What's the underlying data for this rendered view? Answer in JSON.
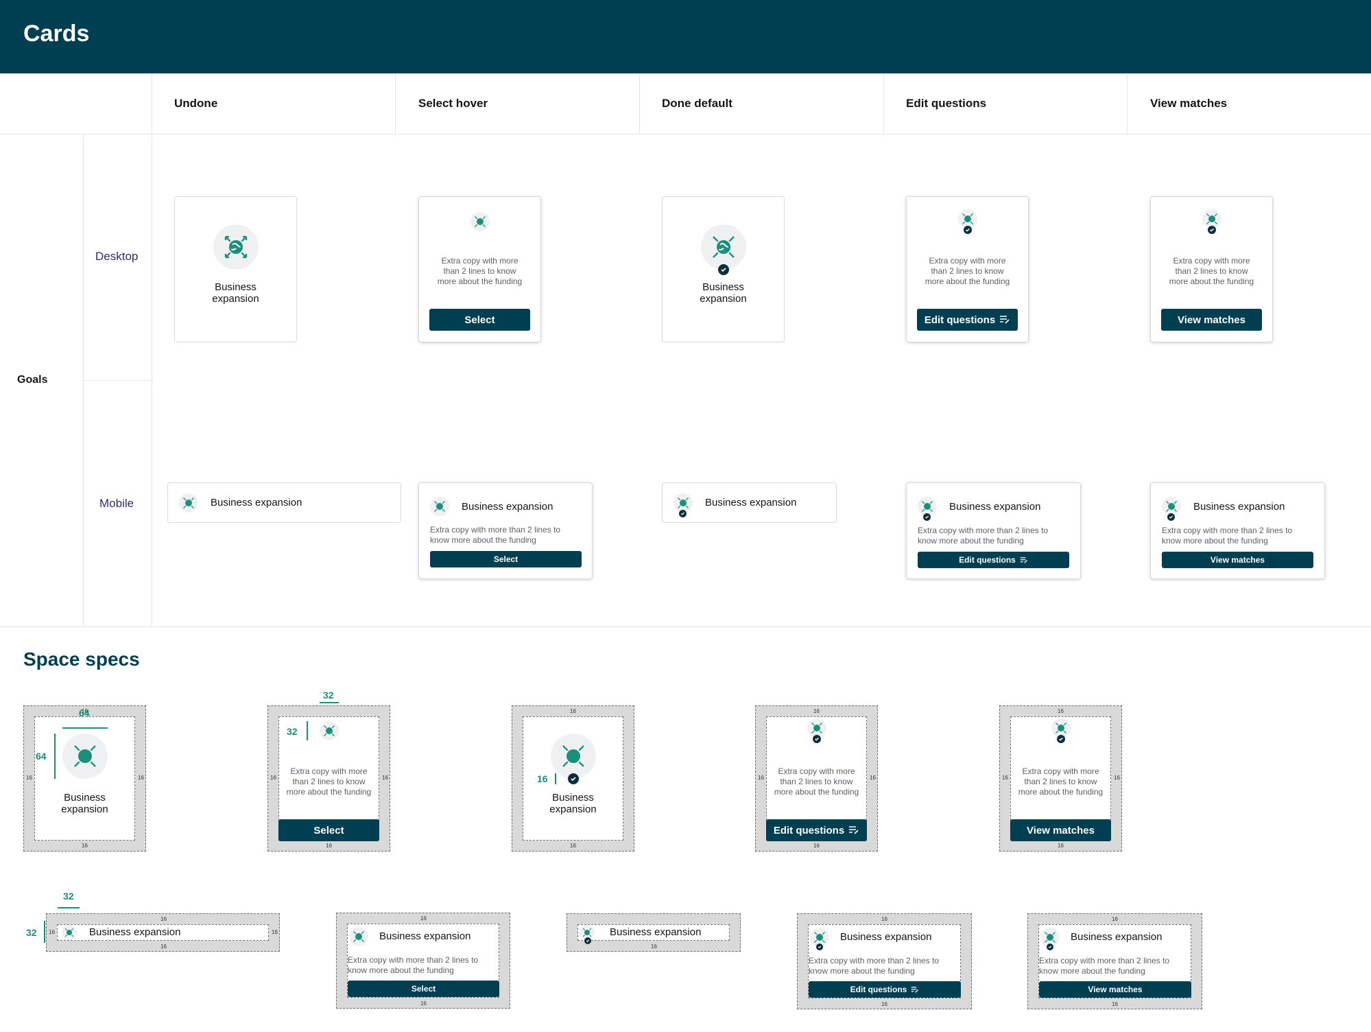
{
  "header": {
    "title": "Cards"
  },
  "columns": [
    "Undone",
    "Select hover",
    "Done default",
    "Edit questions",
    "View matches"
  ],
  "rows": {
    "group": "Goals",
    "desktop": "Desktop",
    "mobile": "Mobile"
  },
  "card": {
    "title_line1": "Business",
    "title_line2": "expansion",
    "title_full": "Business expansion",
    "extra_l1": "Extra copy with more",
    "extra_l2": "than 2 lines to know",
    "extra_l3": "more about the funding",
    "mextra_l1": "Extra copy with more than 2 lines to",
    "mextra_l2": "know more about the funding"
  },
  "buttons": {
    "select": "Select",
    "edit": "Edit questions",
    "view": "View matches"
  },
  "specs": {
    "title": "Space specs",
    "dims": {
      "d16": "16",
      "d32": "32",
      "d64": "64"
    }
  },
  "colors": {
    "brand": "#003f52",
    "accent": "#1a8f7a",
    "icon_bg": "#eef0f1"
  },
  "icons": {
    "goal": "globe-expand-icon",
    "done": "check-circle-icon",
    "edit": "edit-list-icon"
  }
}
